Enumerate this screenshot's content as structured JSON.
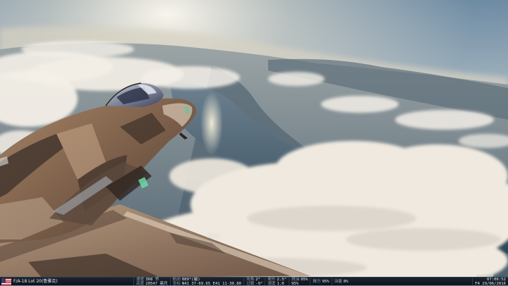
{
  "status_bar": {
    "flag_icon": "usa-flag-icon",
    "unit_name": "F/A-18 Lot 20(鲁雅克)",
    "fields": {
      "spd_label": "速度",
      "spd_value": "368 节",
      "alt_label": "高度",
      "alt_value": "20547 英尺",
      "hdg_label": "航向",
      "hdg_value": "089°(磁)",
      "coord_label": "坐标",
      "coord_value": "N41 37-69.65 E41 11-30.80",
      "aoa_label": "攻角",
      "aoa_value": "2°",
      "g_label": "过载",
      "g_value": "-9°",
      "vs_label": "爬升",
      "vs_value": "2.5°",
      "vs2_label": "速度",
      "vs2_value": "1.0",
      "fuel_label": "燃油",
      "fuel_value": "95%",
      "fuel2_value": "95%",
      "thrust_label": "推力",
      "thrust_value": "95%",
      "thrust2_label": "油量",
      "thrust2_value": "8%"
    },
    "time": "07:06:52",
    "date": "F4 29/06/2016"
  },
  "colors": {
    "sky_top": "#6f8aa2",
    "sky_horizon": "#e9dfc8",
    "water": "#3f5668",
    "cloud": "#f2eee6",
    "aircraft_tan": "#8a6a52",
    "aircraft_dark": "#3d3029"
  }
}
